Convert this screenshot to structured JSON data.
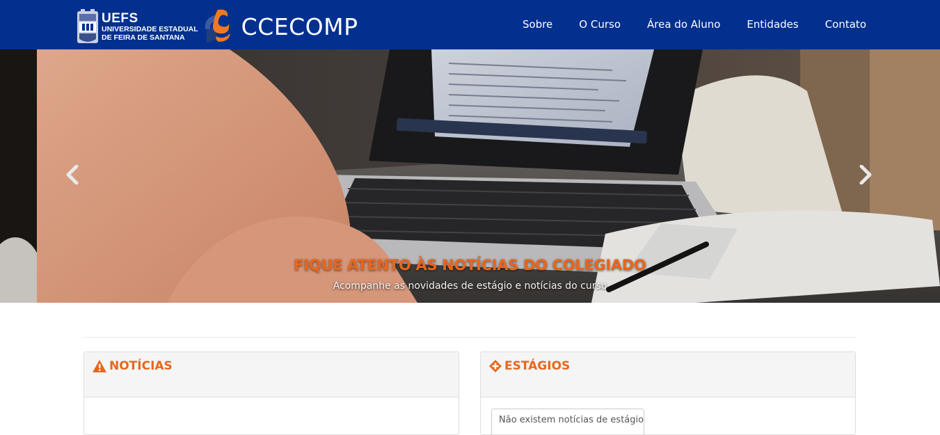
{
  "header": {
    "uefs_abbr": "UEFS",
    "uefs_line1": "UNIVERSIDADE ESTADUAL",
    "uefs_line2": "DE FEIRA DE SANTANA",
    "site_title": "CCECOMP",
    "background_color": "#03308f",
    "nav": [
      {
        "label": "Sobre"
      },
      {
        "label": "O Curso"
      },
      {
        "label": "Área do Aluno"
      },
      {
        "label": "Entidades"
      },
      {
        "label": "Contato"
      }
    ]
  },
  "carousel": {
    "caption_title": "FIQUE ATENTO ÀS NOTÍCIAS DO COLEGIADO",
    "caption_text": "Acompanhe as novidades de estágio e notícias do curso",
    "prev_icon": "chevron-left-icon",
    "next_icon": "chevron-right-icon",
    "accent_color": "#e8661c"
  },
  "panels": {
    "news": {
      "title": "NOTÍCIAS",
      "icon": "warning-triangle-icon"
    },
    "internships": {
      "title": "ESTÁGIOS",
      "icon": "plus-diamond-icon",
      "empty_text": "Não existem notícias de estágio"
    }
  }
}
